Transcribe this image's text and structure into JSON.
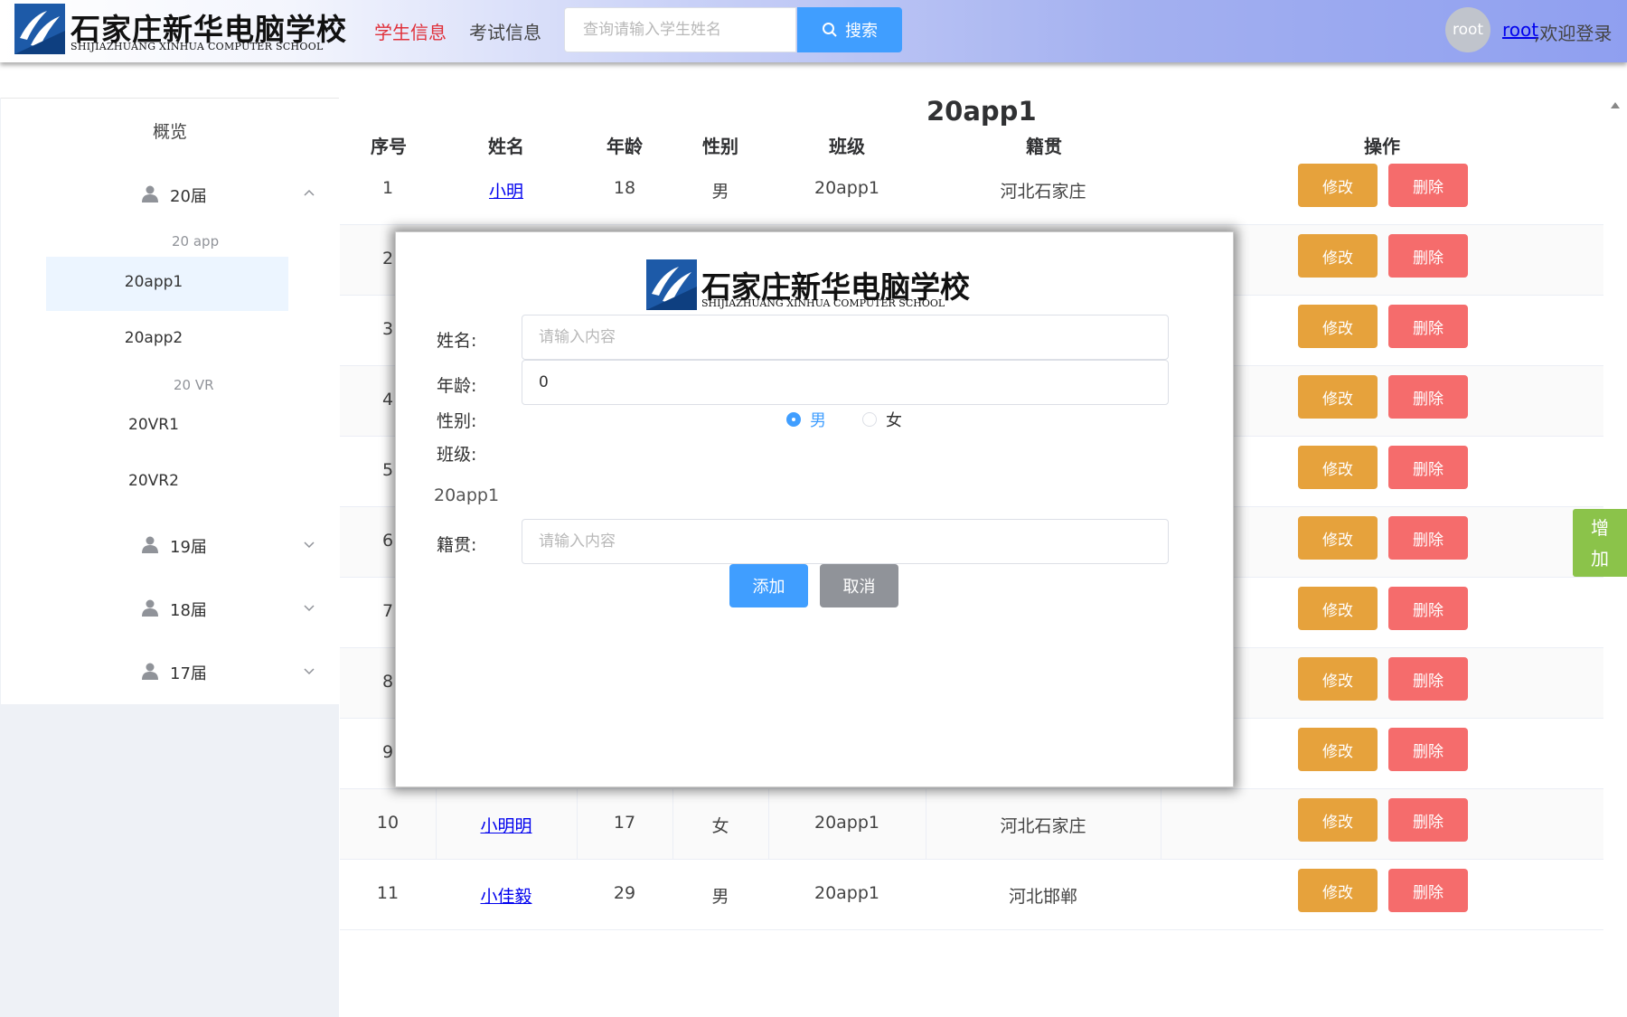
{
  "header": {
    "logo_text": "石家庄新华电脑学校",
    "logo_subtext": "SHIJIAZHUANG XINHUA COMPUTER SCHOOL",
    "nav": [
      "学生信息",
      "考试信息"
    ],
    "search_placeholder": "查询请输入学生姓名",
    "search_button": "搜索",
    "avatar_text": "root",
    "user_link": "root",
    "welcome": ",欢迎登录"
  },
  "sidebar": {
    "title": "概览",
    "groups": [
      {
        "label": "20届",
        "expanded": true,
        "subgroups": [
          {
            "title": "20 app",
            "items": [
              "20app1",
              "20app2"
            ]
          },
          {
            "title": "20 VR",
            "items": [
              "20VR1",
              "20VR2"
            ]
          }
        ]
      },
      {
        "label": "19届",
        "expanded": false
      },
      {
        "label": "18届",
        "expanded": false
      },
      {
        "label": "17届",
        "expanded": false
      }
    ],
    "active_item": "20app1"
  },
  "table": {
    "title": "20app1",
    "headers": [
      "序号",
      "姓名",
      "年龄",
      "性别",
      "班级",
      "籍贯",
      "操作"
    ],
    "edit_label": "修改",
    "delete_label": "删除",
    "rows": [
      {
        "no": "1",
        "name": "小明",
        "age": "18",
        "gender": "男",
        "class": "20app1",
        "origin": "河北石家庄"
      },
      {
        "no": "2"
      },
      {
        "no": "3"
      },
      {
        "no": "4"
      },
      {
        "no": "5"
      },
      {
        "no": "6"
      },
      {
        "no": "7"
      },
      {
        "no": "8"
      },
      {
        "no": "9"
      },
      {
        "no": "10",
        "name": "小明明",
        "age": "17",
        "gender": "女",
        "class": "20app1",
        "origin": "河北石家庄"
      },
      {
        "no": "11",
        "name": "小佳毅",
        "age": "29",
        "gender": "男",
        "class": "20app1",
        "origin": "河北邯郸"
      }
    ]
  },
  "float_add": [
    "增",
    "加"
  ],
  "modal": {
    "logo_text": "石家庄新华电脑学校",
    "logo_subtext": "SHIJIAZHUANG XINHUA COMPUTER SCHOOL",
    "name_label": "姓名:",
    "name_placeholder": "请输入内容",
    "age_label": "年龄:",
    "age_value": "0",
    "gender_label": "性别:",
    "gender_options": [
      "男",
      "女"
    ],
    "gender_selected": "男",
    "class_label": "班级:",
    "class_value": "20app1",
    "origin_label": "籍贯:",
    "origin_placeholder": "请输入内容",
    "add_button": "添加",
    "cancel_button": "取消"
  },
  "colors": {
    "primary": "#409eff",
    "warning": "#e6a23c",
    "danger": "#f56c6c",
    "info": "#909399",
    "success": "#8bc34a",
    "nav_active": "#e0303a"
  }
}
